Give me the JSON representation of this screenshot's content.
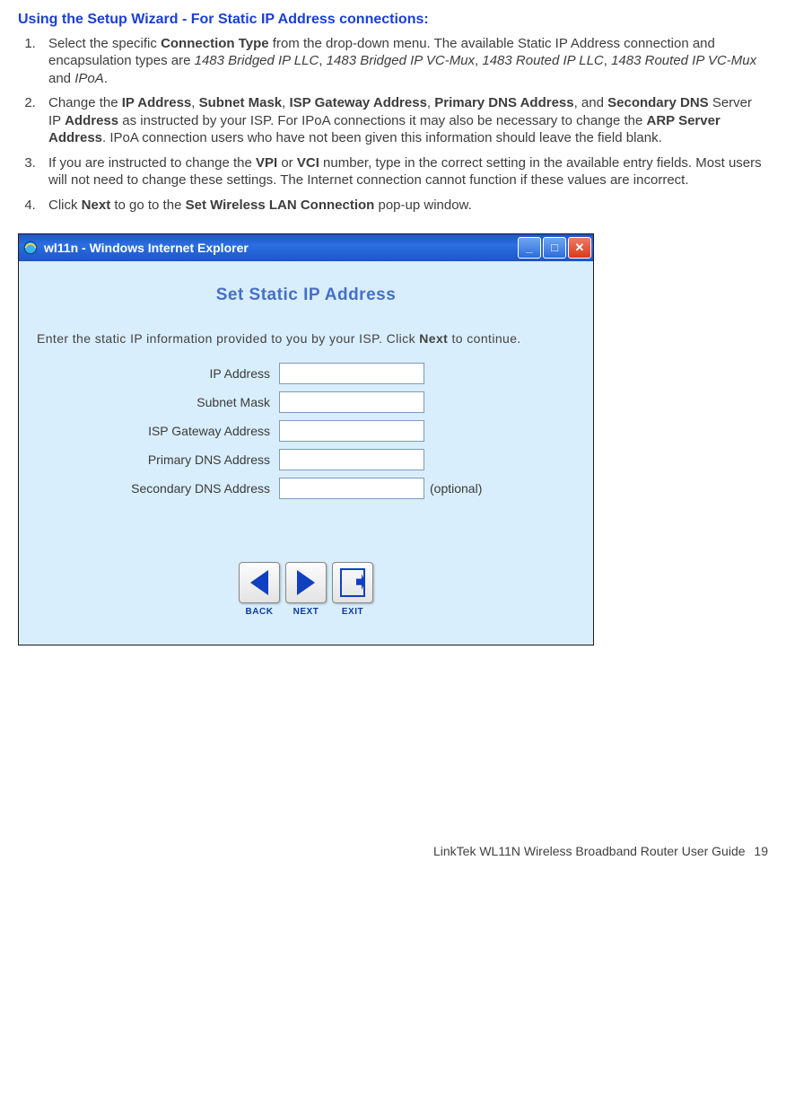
{
  "heading": "Using the Setup Wizard - For Static IP Address connections:",
  "steps": {
    "s1": {
      "t1": "Select the specific ",
      "b1": "Connection Type",
      "t2": " from the drop-down menu. The available Static IP Address connection and encapsulation types are ",
      "i1": "1483 Bridged IP LLC",
      "c1": ", ",
      "i2": "1483 Bridged IP VC-Mux",
      "c2": ", ",
      "i3": "1483 Routed IP LLC",
      "c3": ", ",
      "i4": "1483 Routed IP VC-Mux",
      "t3": " and ",
      "i5": "IPoA",
      "t4": "."
    },
    "s2": {
      "t1": "Change the ",
      "b1": "IP Address",
      "c1": ", ",
      "b2": "Subnet Mask",
      "c2": ", ",
      "b3": "ISP Gateway Address",
      "c3": ", ",
      "b4": "Primary DNS Address",
      "c4": ", and ",
      "b5": "Secondary DNS",
      "t2": " Server IP ",
      "b6": "Address",
      "t3": " as instructed by your ISP. For IPoA connections it may also be necessary to change the ",
      "b7": "ARP Server Address",
      "t4": ". IPoA connection users who have not been given this information should leave the field blank."
    },
    "s3": {
      "t1": "If you are instructed to change the ",
      "b1": "VPI",
      "t2": " or ",
      "b2": "VCI",
      "t3": " number, type in the correct setting in the available entry fields. Most users will not need to change these settings. The Internet connection cannot function if these values are incorrect."
    },
    "s4": {
      "t1": "Click ",
      "b1": "Next",
      "t2": " to go to the ",
      "b2": "Set Wireless LAN Connection",
      "t3": " pop-up window."
    }
  },
  "window": {
    "title": "wl11n - Windows Internet Explorer",
    "wizard_title": "Set  Static  IP  Address",
    "intro1": "Enter the static IP information provided to you by your ISP. Click ",
    "intro_bold": "Next",
    "intro2": " to continue.",
    "labels": {
      "ip": "IP Address",
      "mask": "Subnet Mask",
      "gw": "ISP Gateway Address",
      "pdns": "Primary DNS Address",
      "sdns": "Secondary DNS Address"
    },
    "optional": "(optional)",
    "buttons": {
      "back": "BACK",
      "next": "NEXT",
      "exit": "EXIT"
    }
  },
  "footer": {
    "text": "LinkTek WL11N Wireless Broadband Router User Guide",
    "page": "19"
  }
}
